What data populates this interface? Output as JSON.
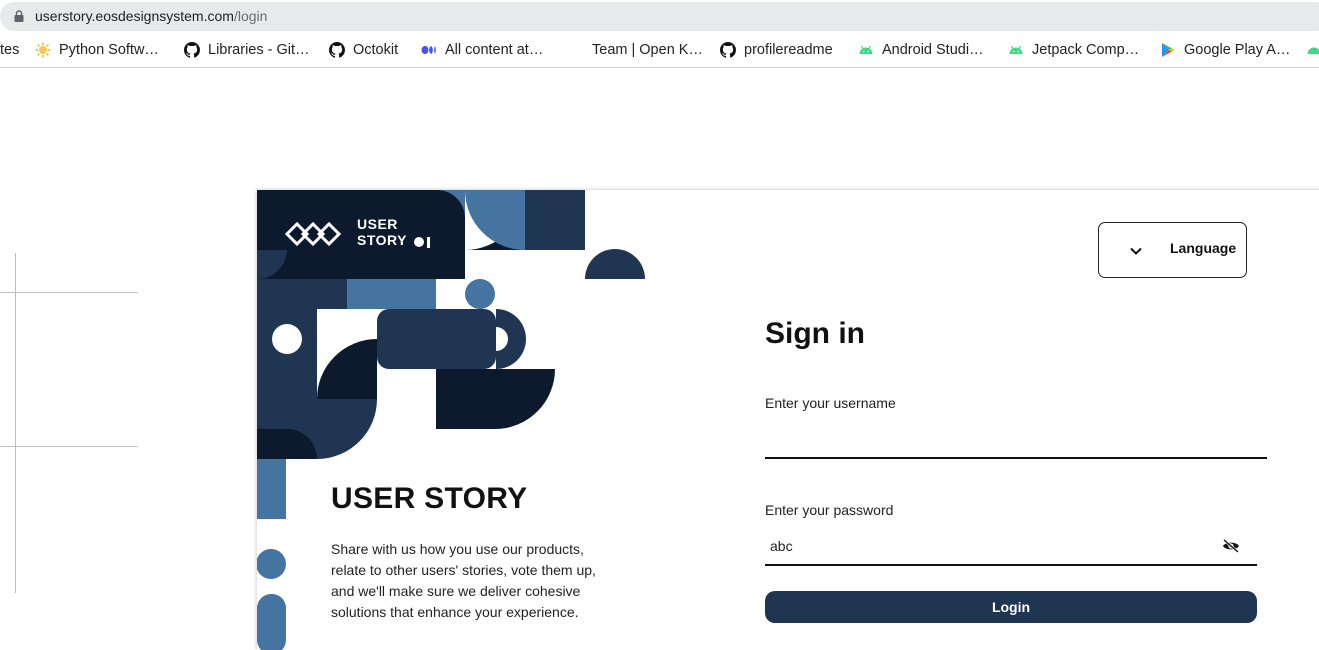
{
  "browser": {
    "url_host": "userstory.eosdesignsystem.com",
    "url_path": "/login",
    "bookmarks": [
      {
        "label": "tes",
        "icon": "none"
      },
      {
        "label": "Python Softw…",
        "icon": "python-icon"
      },
      {
        "label": "Libraries - Git…",
        "icon": "github-icon"
      },
      {
        "label": "Octokit",
        "icon": "github-icon"
      },
      {
        "label": "All content at…",
        "icon": "medium-icon"
      },
      {
        "label": "Team | Open K…",
        "icon": "none"
      },
      {
        "label": "profilereadme",
        "icon": "github-icon"
      },
      {
        "label": "Android Studi…",
        "icon": "android-icon"
      },
      {
        "label": "Jetpack Comp…",
        "icon": "android-icon"
      },
      {
        "label": "Google Play A…",
        "icon": "google-play-icon"
      }
    ]
  },
  "brand": {
    "logo_line1": "USER",
    "logo_line2": "STORY",
    "title": "USER STORY",
    "description": "Share with us how you use our products, relate to other users' stories, vote them up, and we'll make sure we deliver cohesive solutions that enhance your experience."
  },
  "language": {
    "label": "Language",
    "icon": "chevron-down-icon"
  },
  "form": {
    "heading": "Sign in",
    "username_label": "Enter your username",
    "username_value": "",
    "password_label": "Enter your password",
    "password_value": "abc",
    "password_toggle_icon": "eye-off-icon",
    "login_label": "Login"
  },
  "colors": {
    "navy": "#0d1a2d",
    "dark_blue": "#203552",
    "mid_blue": "#4574a1"
  }
}
